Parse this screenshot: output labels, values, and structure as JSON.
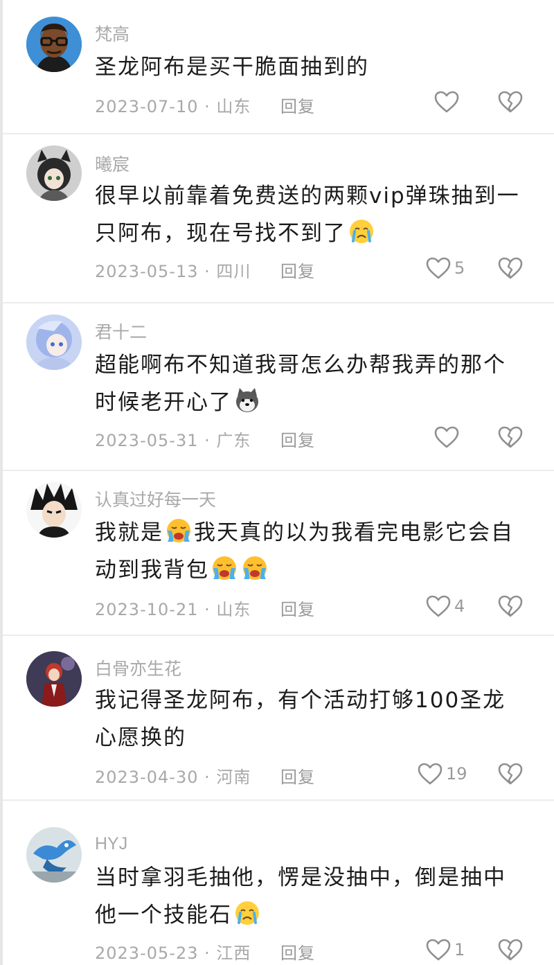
{
  "comments": [
    {
      "username": "梵高",
      "text": "圣龙阿布是买干脆面抽到的",
      "date": "2023-07-10",
      "location": "山东",
      "reply_label": "回复",
      "likes": "",
      "avatar_icon": "cartoon-man-glasses-avatar"
    },
    {
      "username": "曦宸",
      "text_parts": [
        "很早以前靠着免费送的两颗vip弹珠抽到一只阿布，现在号找不到了"
      ],
      "date": "2023-05-13",
      "location": "四川",
      "reply_label": "回复",
      "likes": "5",
      "avatar_icon": "anime-girl-cat-ears-avatar",
      "emoji": "crying-face-emoji"
    },
    {
      "username": "君十二",
      "text_parts": [
        "超能啊布不知道我哥怎么办帮我弄的那个时候老开心了"
      ],
      "date": "2023-05-31",
      "location": "广东",
      "reply_label": "回复",
      "likes": "",
      "avatar_icon": "anime-blue-hair-avatar",
      "emoji": "husky-dog-emoji"
    },
    {
      "username": "认真过好每一天",
      "text_parts": [
        "我就是",
        "我天真的以为我看完电影它会自动到我背包"
      ],
      "date": "2023-10-21",
      "location": "山东",
      "reply_label": "回复",
      "likes": "4",
      "avatar_icon": "anime-spiky-hair-avatar",
      "emoji": "loudly-crying-emoji"
    },
    {
      "username": "白骨亦生花",
      "text": "我记得圣龙阿布，有个活动打够100圣龙心愿换的",
      "date": "2023-04-30",
      "location": "河南",
      "reply_label": "回复",
      "likes": "19",
      "avatar_icon": "anime-red-hair-suit-avatar"
    },
    {
      "username": "HYJ",
      "text_parts": [
        "当时拿羽毛抽他，愣是没抽中，倒是抽中他一个技能石"
      ],
      "date": "2023-05-23",
      "location": "江西",
      "reply_label": "回复",
      "likes": "1",
      "avatar_icon": "blue-dragon-avatar",
      "emoji": "crying-face-emoji"
    }
  ],
  "icons": {
    "like": "heart-outline-icon",
    "dislike": "broken-heart-icon"
  },
  "colors": {
    "username": "#a9a9a9",
    "text": "#1b1b1b",
    "meta": "#a8a8a8",
    "divider": "#ececec"
  }
}
